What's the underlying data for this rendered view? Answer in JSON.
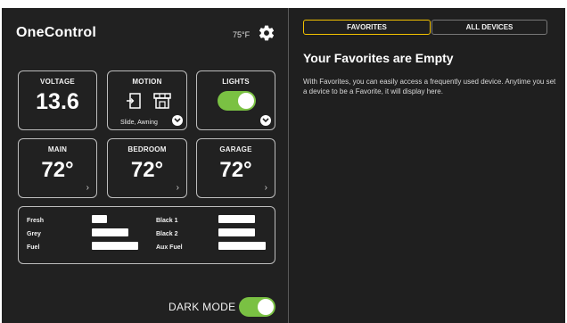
{
  "app": {
    "title": "OneControl",
    "temperature": "75°F"
  },
  "tiles": {
    "voltage": {
      "label": "VOLTAGE",
      "value": "13.6"
    },
    "motion": {
      "label": "MOTION",
      "subtitle": "Slide, Awning"
    },
    "lights": {
      "label": "LIGHTS",
      "state": "on"
    },
    "main": {
      "label": "MAIN",
      "value": "72°"
    },
    "bedroom": {
      "label": "BEDROOM",
      "value": "72°"
    },
    "garage": {
      "label": "GARAGE",
      "value": "72°"
    }
  },
  "tanks": [
    {
      "label": "Fresh"
    },
    {
      "label": "Grey"
    },
    {
      "label": "Fuel"
    },
    {
      "label": "Black 1"
    },
    {
      "label": "Black 2"
    },
    {
      "label": "Aux Fuel"
    }
  ],
  "dark_mode": {
    "label": "DARK MODE",
    "state": "on"
  },
  "favorites": {
    "tabs": [
      "FAVORITES",
      "ALL DEVICES"
    ],
    "active_tab": "FAVORITES",
    "empty_title": "Your Favorites are Empty",
    "empty_text": "With Favorites, you can easily access a frequently used device. Anytime you set a device to be a Favorite, it will display here."
  },
  "colors": {
    "accent_green": "#7ac143",
    "tab_highlight": "#f2c200",
    "background": "#212121"
  }
}
